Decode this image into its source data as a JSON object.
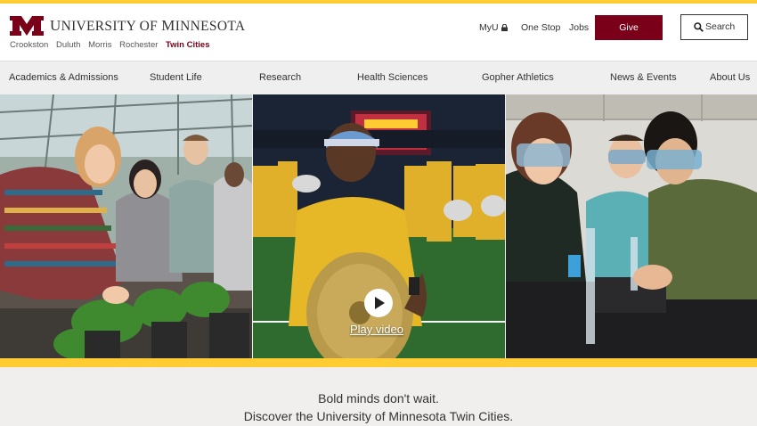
{
  "header": {
    "wordmark_first": "U",
    "wordmark_rest": "NIVERSITY OF ",
    "wordmark_first2": "M",
    "wordmark_rest2": "INNESOTA",
    "campuses": [
      "Crookston",
      "Duluth",
      "Morris",
      "Rochester",
      "Twin Cities"
    ],
    "active_campus": "Twin Cities",
    "brand_color": "#7a0019",
    "gold_color": "#ffcc33"
  },
  "toplinks": {
    "myu": "MyU",
    "onestop": "One Stop",
    "jobs": "Jobs",
    "give": "Give",
    "search": "Search"
  },
  "nav": {
    "items": [
      "Academics & Admissions",
      "Student Life",
      "Research",
      "Health Sciences",
      "Gopher Athletics",
      "News & Events",
      "About Us"
    ]
  },
  "hero": {
    "play_label": "Play video",
    "icons": [
      "lock-icon",
      "search-icon",
      "play-icon"
    ]
  },
  "tagline": {
    "line1": "Bold minds don't wait.",
    "line2": "Discover the University of Minnesota Twin Cities."
  }
}
